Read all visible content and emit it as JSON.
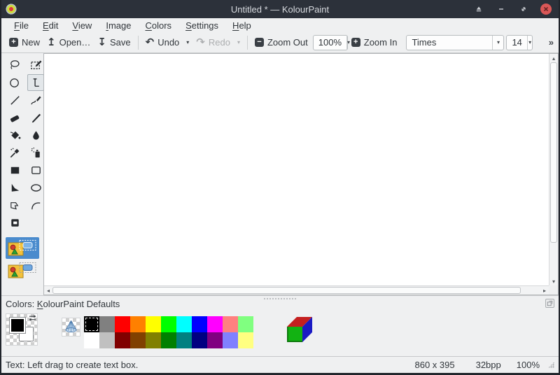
{
  "window": {
    "title": "Untitled * — KolourPaint"
  },
  "titlebar": {
    "icons": [
      "app-icon",
      "keep-above-icon",
      "minimize-icon",
      "restore-icon",
      "close-icon"
    ]
  },
  "menubar": {
    "items": [
      {
        "id": "file",
        "mn": "F",
        "rest": "ile"
      },
      {
        "id": "edit",
        "mn": "E",
        "rest": "dit"
      },
      {
        "id": "view",
        "mn": "V",
        "rest": "iew"
      },
      {
        "id": "image",
        "mn": "I",
        "rest": "mage"
      },
      {
        "id": "colors",
        "mn": "C",
        "rest": "olors"
      },
      {
        "id": "settings",
        "mn": "S",
        "rest": "ettings"
      },
      {
        "id": "help",
        "mn": "H",
        "rest": "elp"
      }
    ]
  },
  "toolbar": {
    "new_label": "New",
    "open_label": "Open…",
    "save_label": "Save",
    "undo_label": "Undo",
    "redo_label": "Redo",
    "zoom_out_label": "Zoom Out",
    "zoom_in_label": "Zoom In",
    "zoom_level": "100%",
    "font_family": "Times",
    "font_size": "14",
    "icons": {
      "new": "+",
      "open": "↥",
      "save": "↧",
      "undo": "↶",
      "redo": "↷",
      "zoom_out": "−",
      "zoom_in": "+",
      "dropdown": "▾",
      "overflow": "»"
    }
  },
  "tools": {
    "items": [
      {
        "id": "selection-free-form"
      },
      {
        "id": "selection-rectangular"
      },
      {
        "id": "selection-elliptical"
      },
      {
        "id": "text",
        "selected": true
      },
      {
        "id": "line"
      },
      {
        "id": "pen"
      },
      {
        "id": "eraser"
      },
      {
        "id": "brush"
      },
      {
        "id": "flood-fill"
      },
      {
        "id": "color-eraser"
      },
      {
        "id": "color-picker"
      },
      {
        "id": "spraycan"
      },
      {
        "id": "rectangle"
      },
      {
        "id": "rounded-rectangle"
      },
      {
        "id": "polygon"
      },
      {
        "id": "ellipse"
      },
      {
        "id": "connected-lines"
      },
      {
        "id": "curve"
      },
      {
        "id": "zoom"
      }
    ],
    "selection_options": [
      {
        "id": "opaque",
        "selected": true
      },
      {
        "id": "transparent",
        "selected": false
      }
    ]
  },
  "scroll_icons": {
    "up": "▴",
    "down": "▾",
    "left": "◂",
    "right": "▸"
  },
  "colors_dock": {
    "label_prefix": "Colors: ",
    "label_mnemonic": "K",
    "label_rest": "olourPaint Defaults",
    "foreground": "#000000",
    "background": "#ffffff",
    "selection_blue": "#4a8bcd",
    "palette_rows": [
      [
        "#000000",
        "#808080",
        "#ff0000",
        "#ff8000",
        "#ffff00",
        "#00ff00",
        "#00ffff",
        "#0000ff",
        "#ff00ff",
        "#ff8080",
        "#80ff80"
      ],
      [
        "#ffffff",
        "#c0c0c0",
        "#800000",
        "#804000",
        "#808000",
        "#008000",
        "#008080",
        "#000080",
        "#800080",
        "#8080ff",
        "#ffff80"
      ]
    ]
  },
  "statusbar": {
    "message": "Text: Left drag to create text box.",
    "dimensions": "860 x 395",
    "color_depth": "32bpp",
    "zoom": "100%"
  }
}
